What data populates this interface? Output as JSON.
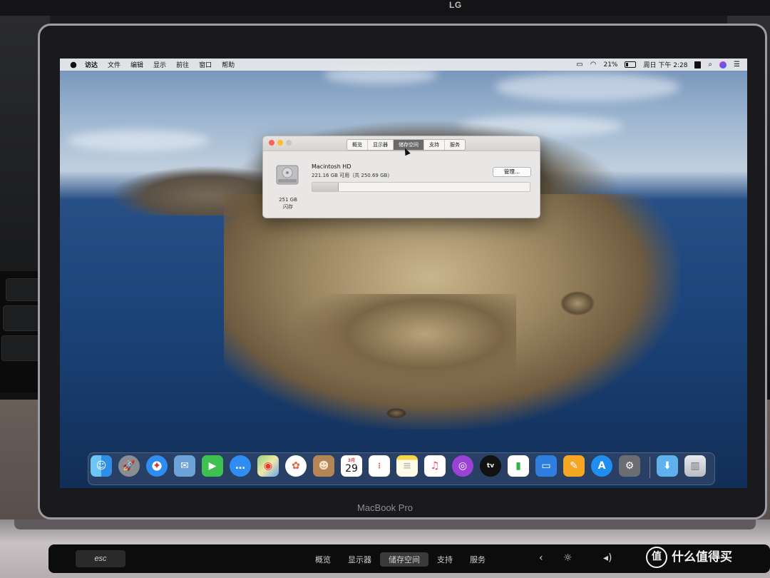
{
  "monitor": {
    "brand": "LG"
  },
  "laptop": {
    "model": "MacBook Pro"
  },
  "menubar": {
    "items": [
      "访达",
      "文件",
      "编辑",
      "显示",
      "前往",
      "窗口",
      "帮助"
    ],
    "battery": "21%",
    "clock": "周日 下午 2:28"
  },
  "window": {
    "tabs": [
      "概览",
      "显示器",
      "储存空间",
      "支持",
      "服务"
    ],
    "active_tab": "储存空间",
    "disk_name": "Macintosh HD",
    "disk_available": "221.16 GB 可用（共 250.69 GB）",
    "disk_size": "251 GB",
    "disk_type": "闪存",
    "manage_label": "管理...",
    "used_fraction": 0.118
  },
  "dock": {
    "calendar_month": "3月",
    "calendar_day": "29",
    "tv_label": "tv",
    "apps": [
      "finder-icon",
      "launchpad-icon",
      "safari-icon",
      "mail-icon",
      "facetime-icon",
      "messages-icon",
      "maps-icon",
      "photos-icon",
      "contacts-icon",
      "calendar-icon",
      "reminders-icon",
      "notes-icon",
      "music-icon",
      "podcasts-icon",
      "tv-icon",
      "numbers-icon",
      "keynote-icon",
      "pages-icon",
      "app-store-icon",
      "system-preferences-icon"
    ],
    "stack": [
      "downloads-folder-icon",
      "trash-icon"
    ]
  },
  "touchbar": {
    "esc": "esc",
    "tabs": [
      "概览",
      "显示器",
      "储存空间",
      "支持",
      "服务"
    ],
    "active_tab": "储存空间"
  },
  "watermark": {
    "badge": "值",
    "text": "什么值得买"
  }
}
